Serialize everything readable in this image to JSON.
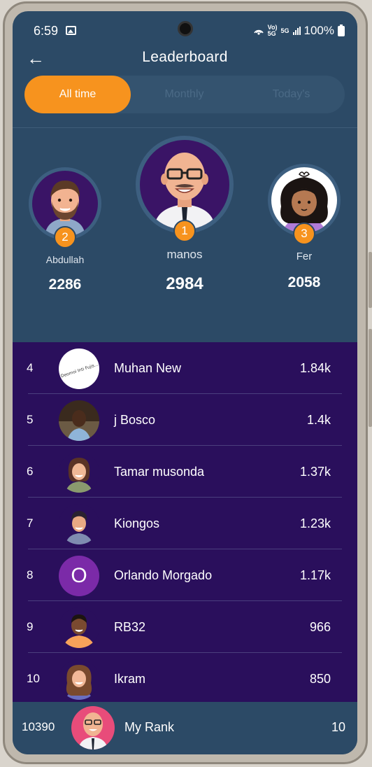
{
  "status_bar": {
    "time": "6:59",
    "network_label": "5G",
    "battery": "100%"
  },
  "header": {
    "title": "Leaderboard",
    "back_icon": "arrow-left-icon"
  },
  "tabs": [
    {
      "label": "All time",
      "active": true
    },
    {
      "label": "Monthly",
      "active": false
    },
    {
      "label": "Today's",
      "active": false
    }
  ],
  "podium": {
    "first": {
      "rank": "1",
      "name": "manos",
      "score": "2984"
    },
    "second": {
      "rank": "2",
      "name": "Abdullah",
      "score": "2286"
    },
    "third": {
      "rank": "3",
      "name": "Fer",
      "score": "2058"
    }
  },
  "list": [
    {
      "rank": "4",
      "name": "Muhan New",
      "score": "1.84k",
      "avatar_text": "Deomoi Inti Fujis..."
    },
    {
      "rank": "5",
      "name": "j Bosco",
      "score": "1.4k"
    },
    {
      "rank": "6",
      "name": "Tamar musonda",
      "score": "1.37k"
    },
    {
      "rank": "7",
      "name": "Kiongos",
      "score": "1.23k"
    },
    {
      "rank": "8",
      "name": "Orlando Morgado",
      "score": "1.17k",
      "avatar_text": "O"
    },
    {
      "rank": "9",
      "name": "RB32",
      "score": "966"
    },
    {
      "rank": "10",
      "name": "Ikram",
      "score": "850"
    }
  ],
  "my_rank": {
    "position": "10390",
    "label": "My Rank",
    "rank": "10"
  },
  "colors": {
    "accent": "#f7931e",
    "header_bg": "#2c4a66",
    "list_bg": "#2a0f5c",
    "tab_inactive_text": "#4b6a86"
  }
}
